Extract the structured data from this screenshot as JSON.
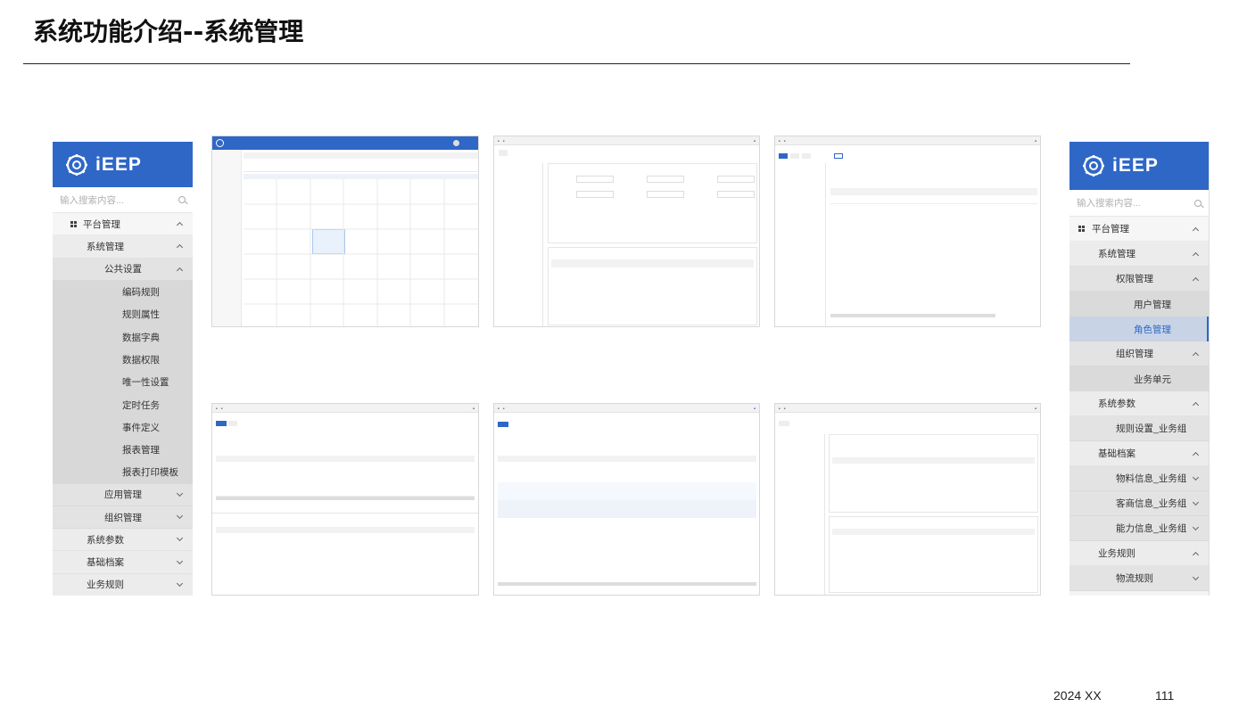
{
  "slide": {
    "title": "系统功能介绍--系统管理",
    "footer_date": "2024 XX",
    "page_number": "111"
  },
  "brand": {
    "logo_text": "iEEP",
    "accent": "#2f67c6"
  },
  "left_menu": {
    "search_placeholder": "输入搜索内容...",
    "items": [
      {
        "label": "平台管理",
        "level": 1,
        "state": "expanded",
        "icon": "grid-icon"
      },
      {
        "label": "系统管理",
        "level": 2,
        "state": "expanded"
      },
      {
        "label": "公共设置",
        "level": 3,
        "state": "expanded"
      },
      {
        "label": "编码规则",
        "level": 4
      },
      {
        "label": "规则属性",
        "level": 4
      },
      {
        "label": "数据字典",
        "level": 4
      },
      {
        "label": "数据权限",
        "level": 4
      },
      {
        "label": "唯一性设置",
        "level": 4
      },
      {
        "label": "定时任务",
        "level": 4
      },
      {
        "label": "事件定义",
        "level": 4
      },
      {
        "label": "报表管理",
        "level": 4
      },
      {
        "label": "报表打印模板",
        "level": 4
      },
      {
        "label": "应用管理",
        "level": 3,
        "state": "collapsed"
      },
      {
        "label": "组织管理",
        "level": 3,
        "state": "collapsed"
      },
      {
        "label": "系统参数",
        "level": 2,
        "state": "collapsed"
      },
      {
        "label": "基础档案",
        "level": 2,
        "state": "collapsed"
      },
      {
        "label": "业务规则",
        "level": 2,
        "state": "collapsed"
      }
    ]
  },
  "right_menu": {
    "search_placeholder": "输入搜索内容...",
    "items": [
      {
        "label": "平台管理",
        "level": 1,
        "state": "expanded",
        "icon": "grid-icon"
      },
      {
        "label": "系统管理",
        "level": 2,
        "state": "expanded"
      },
      {
        "label": "权限管理",
        "level": 3,
        "state": "expanded"
      },
      {
        "label": "用户管理",
        "level": 4
      },
      {
        "label": "角色管理",
        "level": 4,
        "active": true
      },
      {
        "label": "组织管理",
        "level": 3,
        "state": "expanded"
      },
      {
        "label": "业务单元",
        "level": 4
      },
      {
        "label": "系统参数",
        "level": 2,
        "state": "expanded"
      },
      {
        "label": "规则设置_业务组",
        "level": 3
      },
      {
        "label": "基础档案",
        "level": 2,
        "state": "expanded"
      },
      {
        "label": "物料信息_业务组",
        "level": 3,
        "state": "collapsed"
      },
      {
        "label": "客商信息_业务组",
        "level": 3,
        "state": "collapsed"
      },
      {
        "label": "能力信息_业务组",
        "level": 3,
        "state": "collapsed"
      },
      {
        "label": "业务规则",
        "level": 2,
        "state": "expanded"
      },
      {
        "label": "物流规则",
        "level": 3,
        "state": "collapsed"
      }
    ]
  },
  "thumbnails": [
    {
      "name": "calendar-screenshot"
    },
    {
      "name": "form-screenshot"
    },
    {
      "name": "tree-table-screenshot"
    },
    {
      "name": "list-screenshot"
    },
    {
      "name": "grid-list-screenshot"
    },
    {
      "name": "split-table-screenshot"
    }
  ]
}
